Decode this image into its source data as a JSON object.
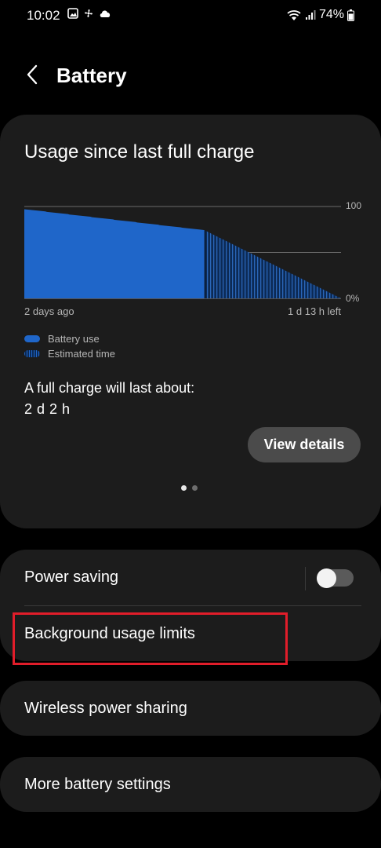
{
  "status_bar": {
    "time": "10:02",
    "left_icons": [
      "gallery-icon",
      "pinwheel-icon",
      "cloud-icon"
    ],
    "right_icons": [
      "wifi-icon",
      "signal-icon",
      "battery-icon"
    ],
    "battery_percent": "74%"
  },
  "header": {
    "back_icon": "chevron-left-icon",
    "title": "Battery"
  },
  "usage_card": {
    "title": "Usage since last full charge",
    "chart_y_top_label": "100",
    "chart_y_bottom_label": "0%",
    "chart_x_left_label": "2 days ago",
    "chart_x_right_label": "1 d 13 h left",
    "legend": [
      {
        "label": "Battery use",
        "style": "solid"
      },
      {
        "label": "Estimated time",
        "style": "striped"
      }
    ],
    "full_charge_label": "A full charge will last about:",
    "full_charge_value": "2 d 2 h",
    "view_details_label": "View details",
    "page_count": 2,
    "current_page": 1
  },
  "chart_data": {
    "type": "area",
    "y_range": [
      0,
      100
    ],
    "battery_use": {
      "start_level": 97,
      "end_level": 74,
      "fraction_of_timeline": 0.57
    },
    "estimated": {
      "start_level": 74,
      "end_level": 0
    },
    "gridlines": [
      100,
      50,
      0
    ]
  },
  "settings": {
    "power_saving_label": "Power saving",
    "power_saving_on": false,
    "background_limits_label": "Background usage limits",
    "wireless_sharing_label": "Wireless power sharing",
    "more_settings_label": "More battery settings"
  },
  "colors": {
    "accent": "#1f66c9",
    "highlight": "#e11d2a",
    "card": "#1c1c1c",
    "background": "#000000"
  }
}
